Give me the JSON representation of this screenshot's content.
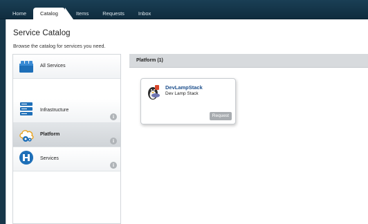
{
  "nav": {
    "tabs": [
      {
        "label": "Home"
      },
      {
        "label": "Catalog"
      },
      {
        "label": "Items"
      },
      {
        "label": "Requests"
      },
      {
        "label": "Inbox"
      }
    ],
    "active_tab": "Catalog"
  },
  "page": {
    "title": "Service Catalog",
    "subtitle": "Browse the catalog for services you need."
  },
  "categories": [
    {
      "label": "All Services",
      "icon": "lego-brick-icon",
      "selected": false
    },
    {
      "label": "Infrastructure",
      "icon": "server-stack-icon",
      "selected": false
    },
    {
      "label": "Platform",
      "icon": "cloud-gear-icon",
      "selected": true
    },
    {
      "label": "Services",
      "icon": "network-node-icon",
      "selected": false
    }
  ],
  "panel": {
    "header": "Platform (1)",
    "items": [
      {
        "title": "DevLampStack",
        "description": "Dev Lamp Stack",
        "icon": "linux-apache-php-icon",
        "button": "Request"
      }
    ]
  },
  "colors": {
    "topbar": "#17374a",
    "link": "#1d4f8c",
    "accent_blue": "#1e6fb8"
  }
}
